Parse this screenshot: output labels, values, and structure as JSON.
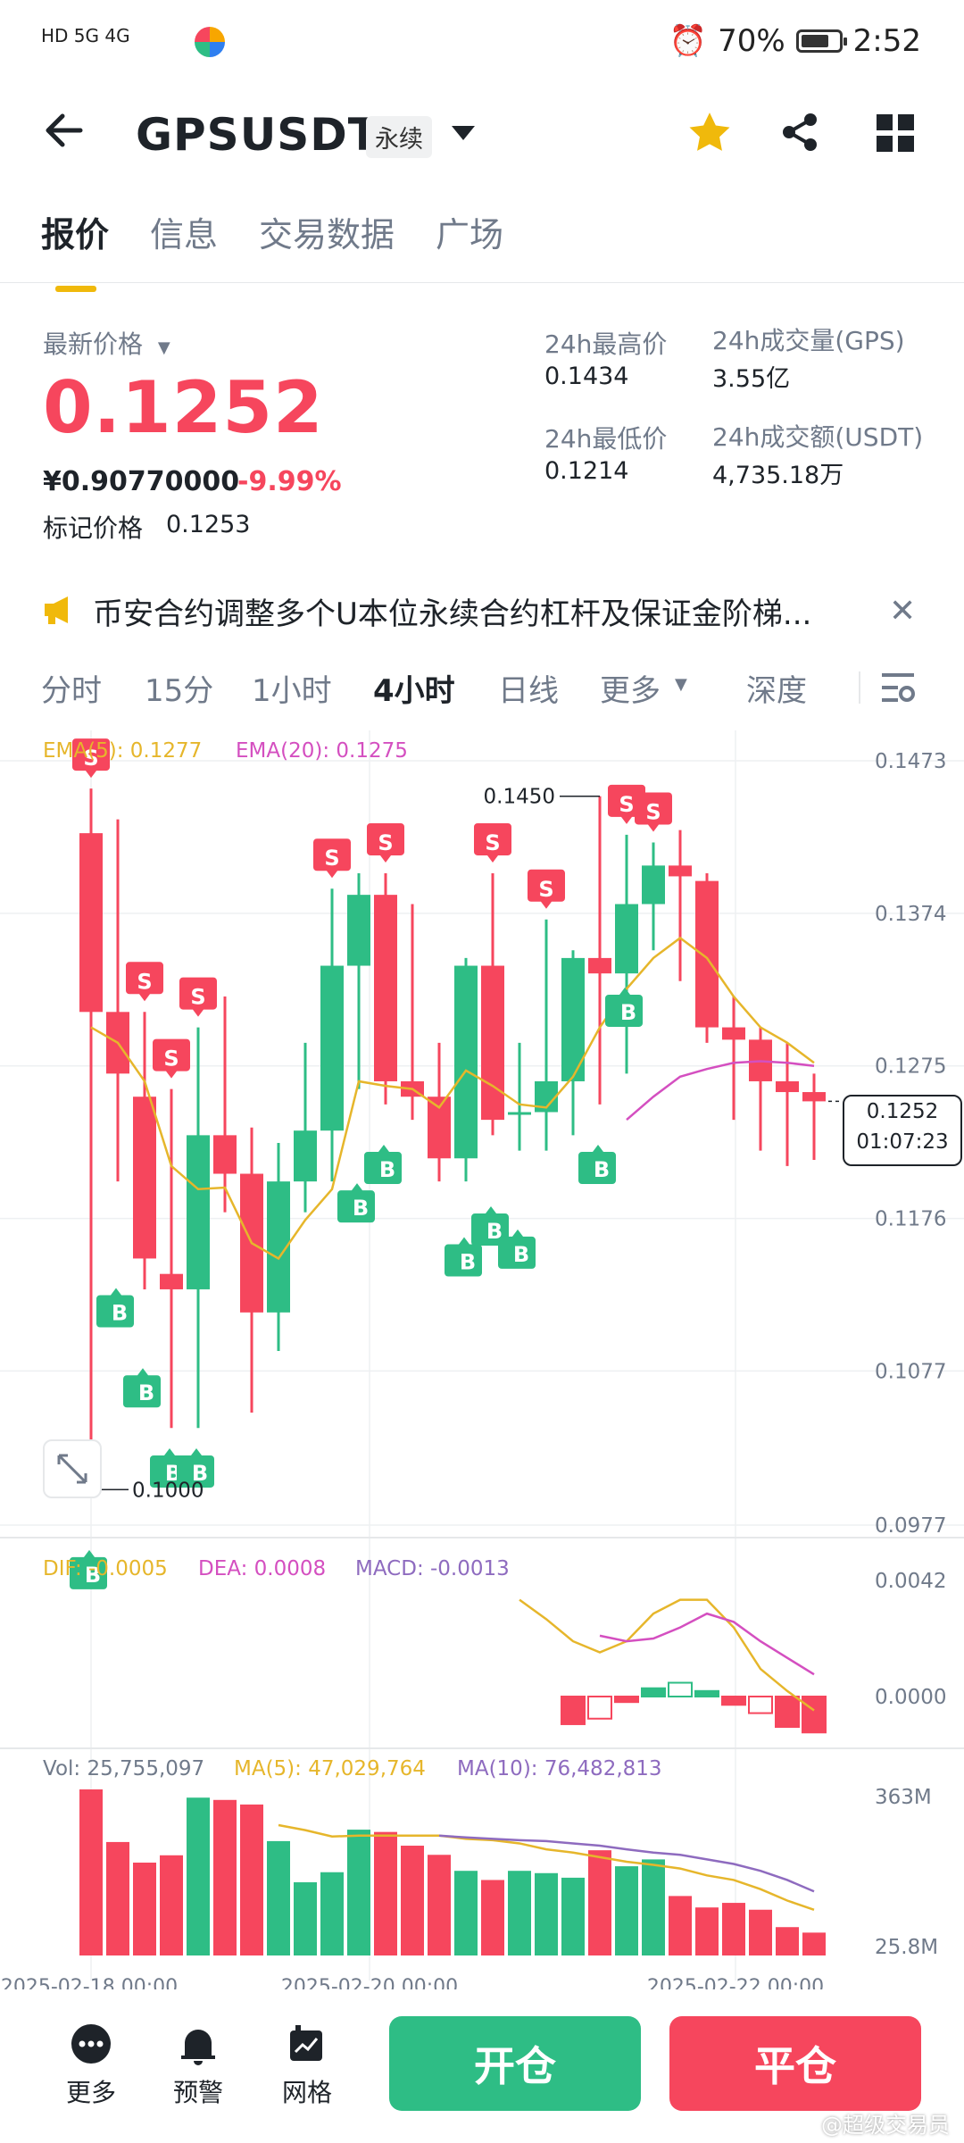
{
  "status_bar": {
    "time": "2:52",
    "battery": "70%",
    "signal_left": "HD 5G 4G"
  },
  "header": {
    "symbol": "GPSUSDT",
    "contract_type": "永续"
  },
  "tabs": [
    "报价",
    "信息",
    "交易数据",
    "广场"
  ],
  "ticker": {
    "latest_label": "最新价格",
    "last_price": "0.1252",
    "cny_price": "¥0.90770000",
    "change_pct": "-9.99%",
    "mark_label": "标记价格",
    "mark_price": "0.1253",
    "high_label": "24h最高价",
    "high": "0.1434",
    "low_label": "24h最低价",
    "low": "0.1214",
    "vol_gps_label": "24h成交量(GPS)",
    "vol_gps": "3.55亿",
    "vol_usdt_label": "24h成交额(USDT)",
    "vol_usdt": "4,735.18万"
  },
  "notice": {
    "text": "币安合约调整多个U本位永续合约杠杆及保证金阶梯..."
  },
  "intervals": [
    "分时",
    "15分",
    "1小时",
    "4小时",
    "日线",
    "更多",
    "深度"
  ],
  "active_interval": "4小时",
  "colors": {
    "up": "#2ebd85",
    "down": "#f6465d",
    "accent": "#f0b90b",
    "ema20": "#d44fc0",
    "ema5": "#e6b62b"
  },
  "chart_data": {
    "type": "candlestick",
    "price_axis_labels": [
      "0.1473",
      "0.1374",
      "0.1275",
      "0.1176",
      "0.1077",
      "0.0977"
    ],
    "ema_label": "EMA(5): 0.1277",
    "ema20_label": "EMA(20): 0.1275",
    "current_price_tag": "0.1252",
    "countdown": "01:07:23",
    "high_marker": "0.1450",
    "low_marker": "0.1000",
    "candles": [
      {
        "o": 0.1426,
        "h": 0.1455,
        "l": 0.1,
        "c": 0.131,
        "s": "S"
      },
      {
        "o": 0.131,
        "h": 0.1435,
        "l": 0.12,
        "c": 0.127,
        "s": ""
      },
      {
        "o": 0.1255,
        "h": 0.131,
        "l": 0.113,
        "c": 0.115,
        "s": "S"
      },
      {
        "o": 0.114,
        "h": 0.126,
        "l": 0.104,
        "c": 0.113,
        "s": "S"
      },
      {
        "o": 0.113,
        "h": 0.13,
        "l": 0.104,
        "c": 0.123,
        "s": "S"
      },
      {
        "o": 0.123,
        "h": 0.132,
        "l": 0.118,
        "c": 0.1205,
        "s": ""
      },
      {
        "o": 0.1205,
        "h": 0.1235,
        "l": 0.105,
        "c": 0.1115,
        "s": ""
      },
      {
        "o": 0.1115,
        "h": 0.1225,
        "l": 0.109,
        "c": 0.12,
        "s": ""
      },
      {
        "o": 0.12,
        "h": 0.129,
        "l": 0.118,
        "c": 0.1233,
        "s": ""
      },
      {
        "o": 0.1233,
        "h": 0.139,
        "l": 0.12,
        "c": 0.134,
        "s": "S"
      },
      {
        "o": 0.134,
        "h": 0.14,
        "l": 0.126,
        "c": 0.1386,
        "s": ""
      },
      {
        "o": 0.1386,
        "h": 0.14,
        "l": 0.125,
        "c": 0.1265,
        "s": "S"
      },
      {
        "o": 0.1265,
        "h": 0.138,
        "l": 0.124,
        "c": 0.1255,
        "s": ""
      },
      {
        "o": 0.1255,
        "h": 0.129,
        "l": 0.12,
        "c": 0.1215,
        "s": ""
      },
      {
        "o": 0.1215,
        "h": 0.1345,
        "l": 0.12,
        "c": 0.134,
        "s": ""
      },
      {
        "o": 0.134,
        "h": 0.14,
        "l": 0.123,
        "c": 0.124,
        "s": "S"
      },
      {
        "o": 0.1245,
        "h": 0.129,
        "l": 0.122,
        "c": 0.1245,
        "s": ""
      },
      {
        "o": 0.1245,
        "h": 0.137,
        "l": 0.122,
        "c": 0.1265,
        "s": "S"
      },
      {
        "o": 0.1265,
        "h": 0.135,
        "l": 0.123,
        "c": 0.1345,
        "s": ""
      },
      {
        "o": 0.1345,
        "h": 0.145,
        "l": 0.125,
        "c": 0.1335,
        "s": ""
      },
      {
        "o": 0.1335,
        "h": 0.1425,
        "l": 0.127,
        "c": 0.138,
        "s": "S"
      },
      {
        "o": 0.138,
        "h": 0.142,
        "l": 0.135,
        "c": 0.1405,
        "s": "S"
      },
      {
        "o": 0.1405,
        "h": 0.1428,
        "l": 0.133,
        "c": 0.1398,
        "s": ""
      },
      {
        "o": 0.1395,
        "h": 0.14,
        "l": 0.129,
        "c": 0.13,
        "s": ""
      },
      {
        "o": 0.13,
        "h": 0.132,
        "l": 0.124,
        "c": 0.1292,
        "s": ""
      },
      {
        "o": 0.1292,
        "h": 0.13,
        "l": 0.122,
        "c": 0.1265,
        "s": ""
      },
      {
        "o": 0.1265,
        "h": 0.129,
        "l": 0.121,
        "c": 0.1258,
        "s": ""
      },
      {
        "o": 0.1258,
        "h": 0.127,
        "l": 0.1214,
        "c": 0.1252,
        "s": ""
      }
    ],
    "buy_markers": [
      {
        "i": 1,
        "p": 0.1132
      },
      {
        "i": 2,
        "p": 0.108
      },
      {
        "i": 3,
        "p": 0.1028
      },
      {
        "i": 4,
        "p": 0.1028
      },
      {
        "i": 10,
        "p": 0.12
      },
      {
        "i": 11,
        "p": 0.1225
      },
      {
        "i": 14,
        "p": 0.1165
      },
      {
        "i": 15,
        "p": 0.1185
      },
      {
        "i": 16,
        "p": 0.117
      },
      {
        "i": 20,
        "p": 0.1327
      },
      {
        "i": 19,
        "p": 0.1225
      },
      {
        "i": 0,
        "p": 0.0962
      }
    ],
    "ema5": [
      0.13,
      0.129,
      0.1265,
      0.121,
      0.1195,
      0.1196,
      0.116,
      0.115,
      0.1175,
      0.1195,
      0.1265,
      0.1262,
      0.126,
      0.1248,
      0.1272,
      0.1262,
      0.125,
      0.1248,
      0.1268,
      0.13,
      0.1325,
      0.1345,
      0.1358,
      0.1345,
      0.132,
      0.13,
      0.129,
      0.1277
    ],
    "ema20": [
      null,
      null,
      null,
      null,
      null,
      null,
      null,
      null,
      null,
      null,
      null,
      null,
      null,
      null,
      null,
      null,
      null,
      null,
      null,
      null,
      0.124,
      0.1255,
      0.1268,
      0.1273,
      0.1277,
      0.1278,
      0.1277,
      0.1275
    ],
    "macd_labels": {
      "dif": "DIF: -0.0005",
      "dea": "DEA: 0.0008",
      "macd": "MACD: -0.0013"
    },
    "macd_axis": [
      "0.0042",
      "0.0000"
    ],
    "macd_hist": [
      0,
      0,
      0,
      0,
      0,
      0,
      0,
      0,
      0,
      0,
      0,
      0,
      0,
      0,
      0,
      0,
      0,
      0,
      -0.001,
      -0.0008,
      -0.0002,
      0.0003,
      0.0005,
      0.0002,
      -0.0003,
      -0.0006,
      -0.0011,
      -0.0013
    ],
    "dif": [
      null,
      null,
      null,
      null,
      null,
      null,
      null,
      null,
      null,
      null,
      null,
      null,
      null,
      null,
      null,
      null,
      0.0035,
      0.0028,
      0.002,
      0.0016,
      0.002,
      0.003,
      0.0035,
      0.0035,
      0.0025,
      0.001,
      0.0002,
      -0.0005
    ],
    "dea": [
      null,
      null,
      null,
      null,
      null,
      null,
      null,
      null,
      null,
      null,
      null,
      null,
      null,
      null,
      null,
      null,
      null,
      null,
      null,
      0.0022,
      0.002,
      0.0021,
      0.0025,
      0.003,
      0.0027,
      0.002,
      0.0014,
      0.0008
    ],
    "vol_labels": {
      "vol": "Vol: 25,755,097",
      "ma5": "MA(5): 47,029,764",
      "ma10": "MA(10): 76,482,813"
    },
    "vol_axis": [
      "363M",
      "25.8M"
    ],
    "volumes": [
      363,
      248,
      203,
      219,
      345,
      340,
      330,
      250,
      160,
      182,
      275,
      270,
      240,
      220,
      185,
      165,
      185,
      180,
      170,
      230,
      195,
      210,
      130,
      105,
      115,
      100,
      62,
      50
    ],
    "vol_ma5": [
      null,
      null,
      null,
      null,
      null,
      null,
      null,
      285,
      274,
      260,
      262,
      262,
      262,
      262,
      255,
      252,
      245,
      232,
      225,
      215,
      205,
      198,
      190,
      175,
      165,
      145,
      120,
      100
    ],
    "vol_ma10": [
      null,
      null,
      null,
      null,
      null,
      null,
      null,
      null,
      null,
      null,
      null,
      null,
      null,
      262,
      258,
      255,
      252,
      250,
      245,
      240,
      232,
      225,
      220,
      210,
      200,
      185,
      165,
      140
    ],
    "x_labels": [
      "2025-02-18 00:00",
      "2025-02-20 00:00",
      "2025-02-22 00:00"
    ]
  },
  "bottom": {
    "more": "更多",
    "alert": "预警",
    "grid": "网格",
    "open": "开仓",
    "close": "平仓",
    "watermark": "@超级交易员"
  }
}
